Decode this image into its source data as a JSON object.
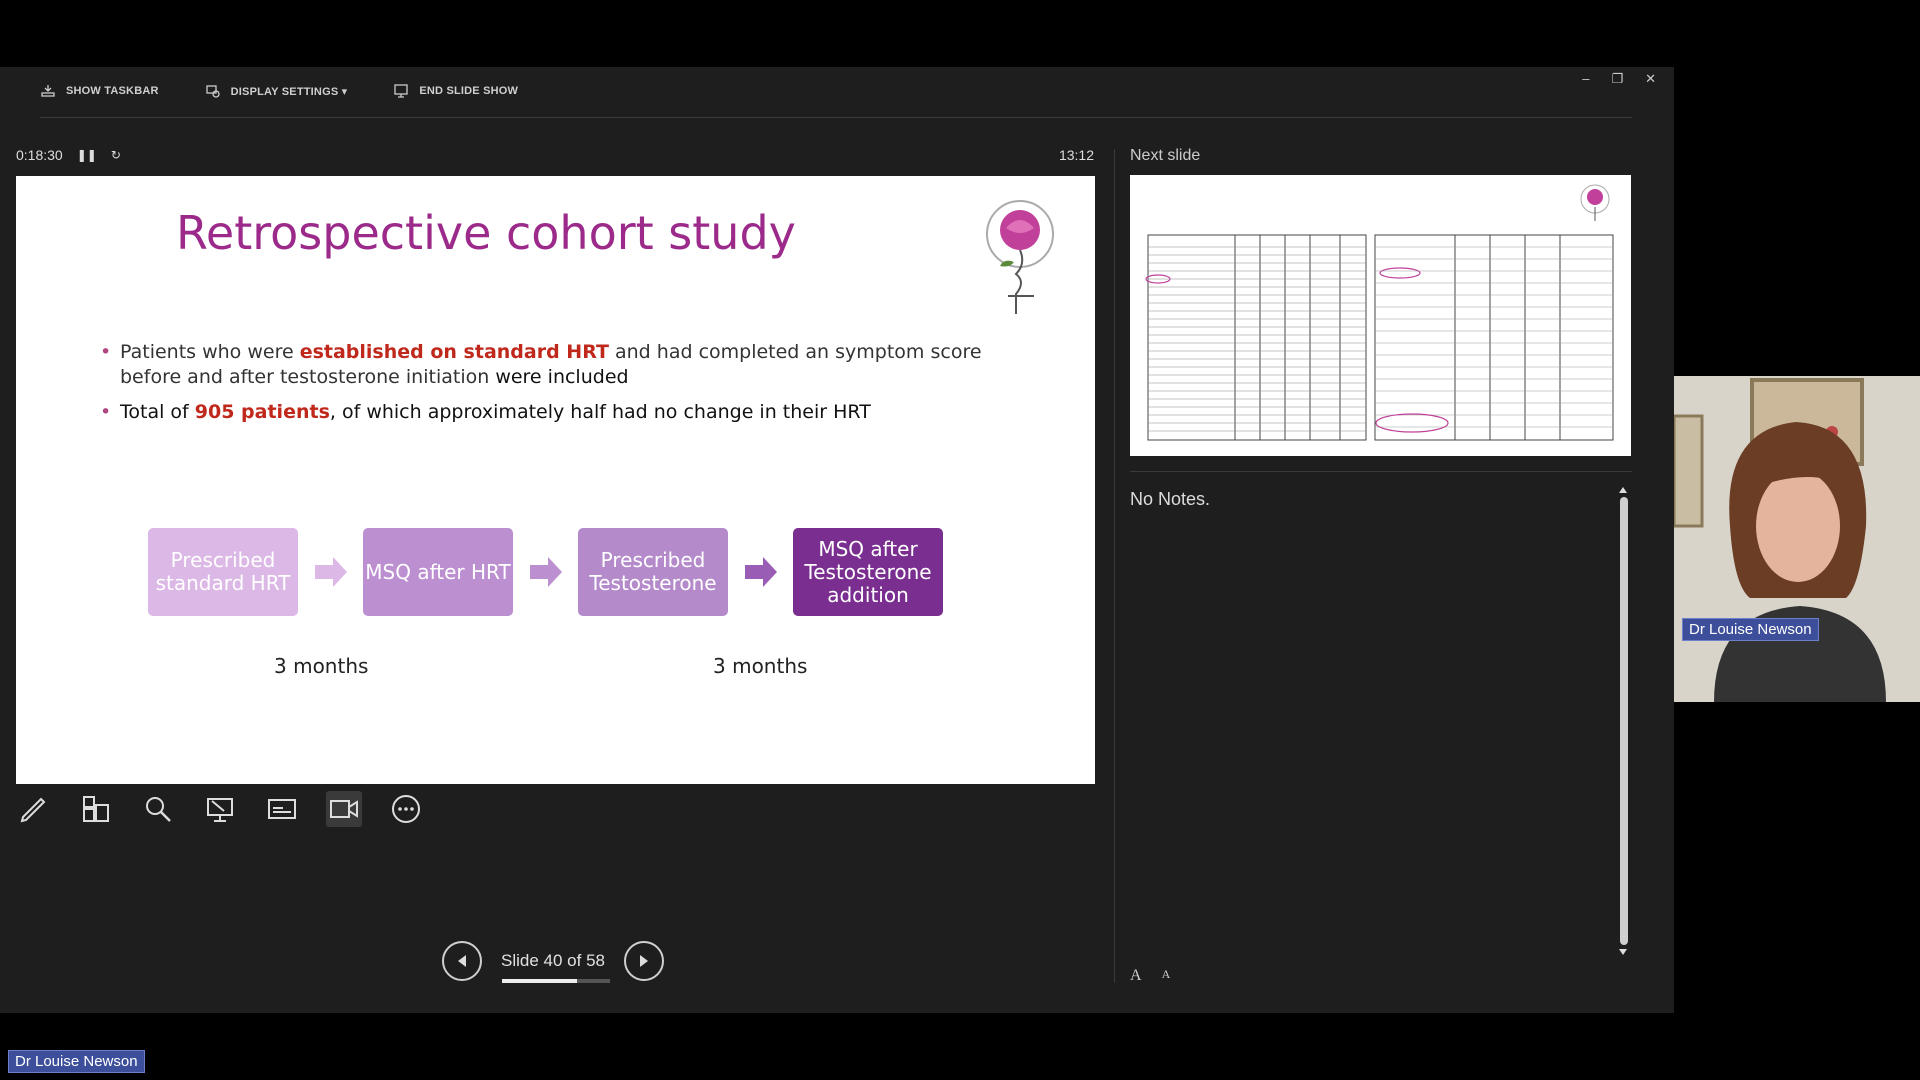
{
  "toolbar": {
    "show_taskbar": "SHOW TASKBAR",
    "display_settings": "DISPLAY SETTINGS ▾",
    "end_slide_show": "END SLIDE SHOW"
  },
  "window_controls": {
    "minimize": "–",
    "restore": "❐",
    "close": "✕"
  },
  "timer": {
    "elapsed": "0:18:30",
    "pause_icon": "pause-icon",
    "reset_icon": "reset-icon",
    "clock": "13:12"
  },
  "slide": {
    "title": "Retrospective cohort study",
    "bullets": [
      {
        "pre": "Patients who were ",
        "highlight": "established on standard HRT",
        "post": " and had completed an symptom score before and after testosterone initiation ",
        "tail": "were included"
      },
      {
        "pre": "Total of ",
        "highlight": "905 patients",
        "post": ", of which approximately half had no change in their HRT"
      }
    ],
    "flow": [
      "Prescribed standard HRT",
      "MSQ after HRT",
      "Prescribed Testosterone",
      "MSQ after Testosterone addition"
    ],
    "months_1": "3 months",
    "months_2": "3 months"
  },
  "tools": [
    "pen-icon",
    "grid-icon",
    "zoom-icon",
    "laser-pointer-icon",
    "subtitles-icon",
    "camera-icon",
    "more-icon"
  ],
  "navigation": {
    "slide_label": "Slide 40 of 58",
    "progress": 0.69
  },
  "next_slide": {
    "label": "Next slide"
  },
  "notes": {
    "text": "No Notes."
  },
  "font_controls": {
    "increase": "A",
    "decrease": "A"
  },
  "video": {
    "name": "Dr Louise Newson"
  },
  "bottom_name": "Dr Louise Newson",
  "colors": {
    "title": "#9b2a8a",
    "highlight": "#c0281c",
    "flow_dark": "#7a2f90"
  }
}
